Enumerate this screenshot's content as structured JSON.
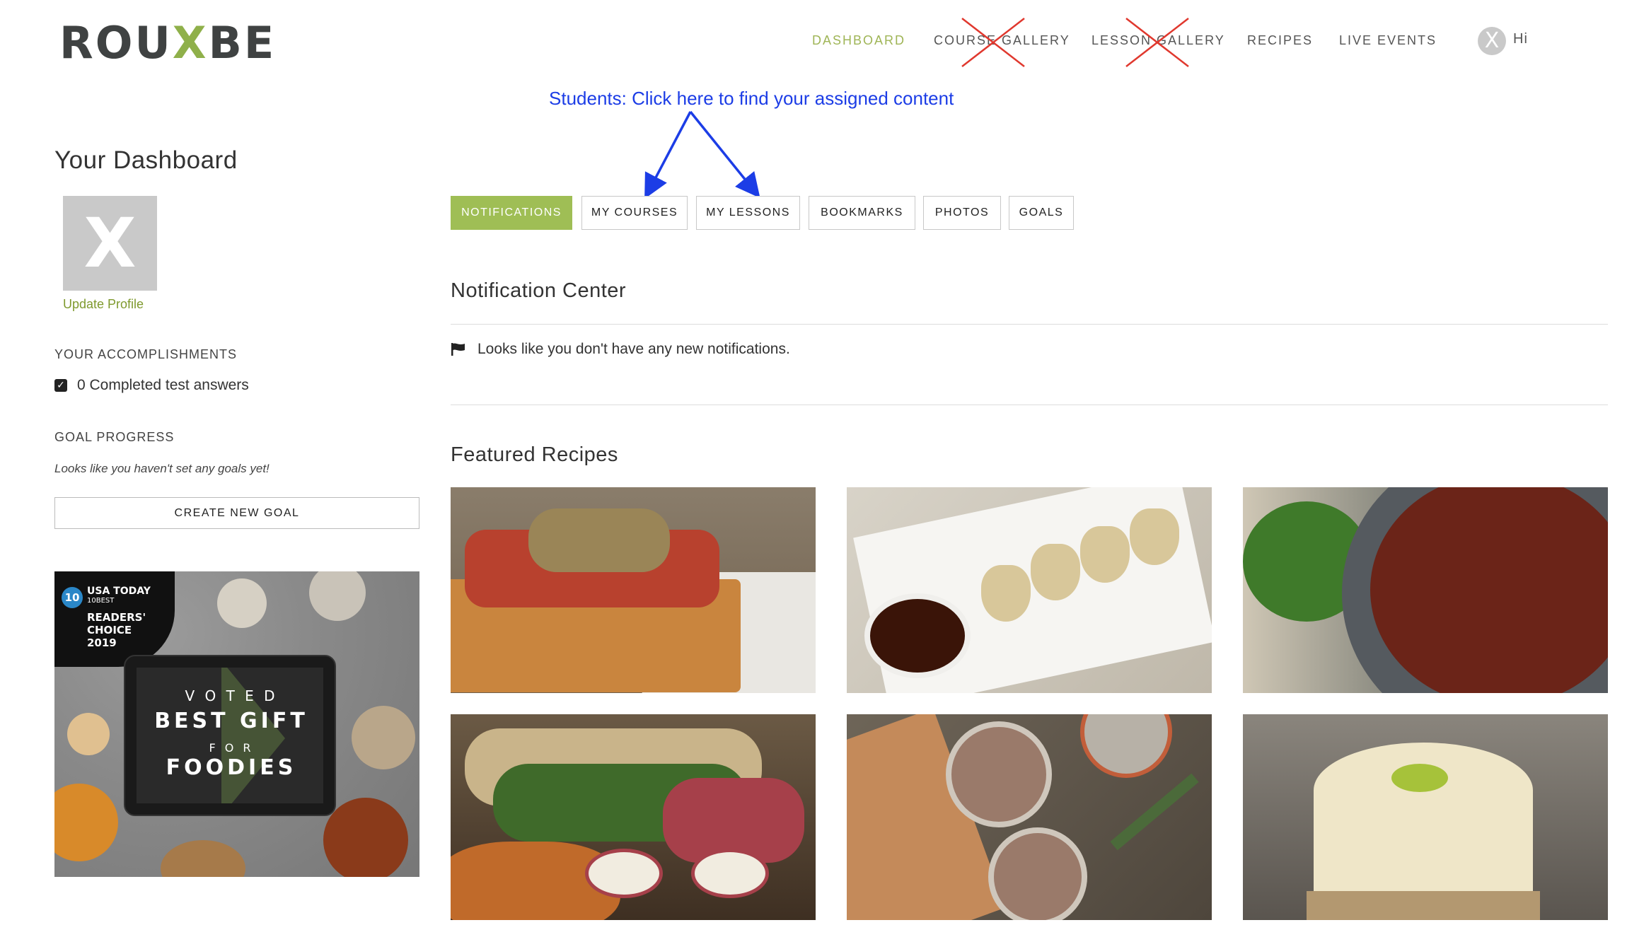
{
  "header": {
    "logo_left": "ROU",
    "logo_x": "X",
    "logo_right": "BE",
    "nav": [
      {
        "label": "DASHBOARD",
        "active": true,
        "struck": false
      },
      {
        "label": "COURSE GALLERY",
        "active": false,
        "struck": true
      },
      {
        "label": "LESSON GALLERY",
        "active": false,
        "struck": true
      },
      {
        "label": "RECIPES",
        "active": false,
        "struck": false
      },
      {
        "label": "LIVE EVENTS",
        "active": false,
        "struck": false
      }
    ],
    "user_avatar_letter": "X",
    "greeting": "Hi"
  },
  "annotation": {
    "text": "Students: Click here to find your assigned content",
    "color": "#1c3de6"
  },
  "sidebar": {
    "title": "Your Dashboard",
    "avatar_letter": "X",
    "update_profile": "Update Profile",
    "accomplishments_heading": "YOUR ACCOMPLISHMENTS",
    "accomplishment": "0 Completed test answers",
    "goal_heading": "GOAL PROGRESS",
    "no_goals": "Looks like you haven't set any goals yet!",
    "create_goal": "CREATE NEW GOAL",
    "promo": {
      "badge_line1": "USA TODAY",
      "badge_line2": "10BEST",
      "badge_line3": "READERS'",
      "badge_line4": "CHOICE",
      "badge_line5": "2019",
      "badge_number": "10",
      "voted": "V O T E D",
      "best_gift": "BEST GIFT",
      "for": "F O R",
      "foodies": "FOODIES"
    }
  },
  "tabs": [
    {
      "label": "NOTIFICATIONS",
      "active": true
    },
    {
      "label": "MY COURSES",
      "active": false
    },
    {
      "label": "MY LESSONS",
      "active": false
    },
    {
      "label": "BOOKMARKS",
      "active": false
    },
    {
      "label": "PHOTOS",
      "active": false
    },
    {
      "label": "GOALS",
      "active": false
    }
  ],
  "notifications": {
    "title": "Notification Center",
    "empty_message": "Looks like you don't have any new notifications."
  },
  "featured": {
    "title": "Featured Recipes",
    "recipes": [
      {
        "name": "bruschetta-recipe",
        "bg": "#6b5a45"
      },
      {
        "name": "dumplings-recipe",
        "bg": "#e8e4dc"
      },
      {
        "name": "tapenade-recipe",
        "bg": "#5a3a2a"
      },
      {
        "name": "cheese-log-recipe",
        "bg": "#4a3a2a"
      },
      {
        "name": "pate-recipe",
        "bg": "#5e554a"
      },
      {
        "name": "cheesecake-recipe",
        "bg": "#6a6660"
      }
    ]
  },
  "colors": {
    "accent": "#9fbe55",
    "link": "#7f9a2e",
    "strike": "#e0382e"
  }
}
